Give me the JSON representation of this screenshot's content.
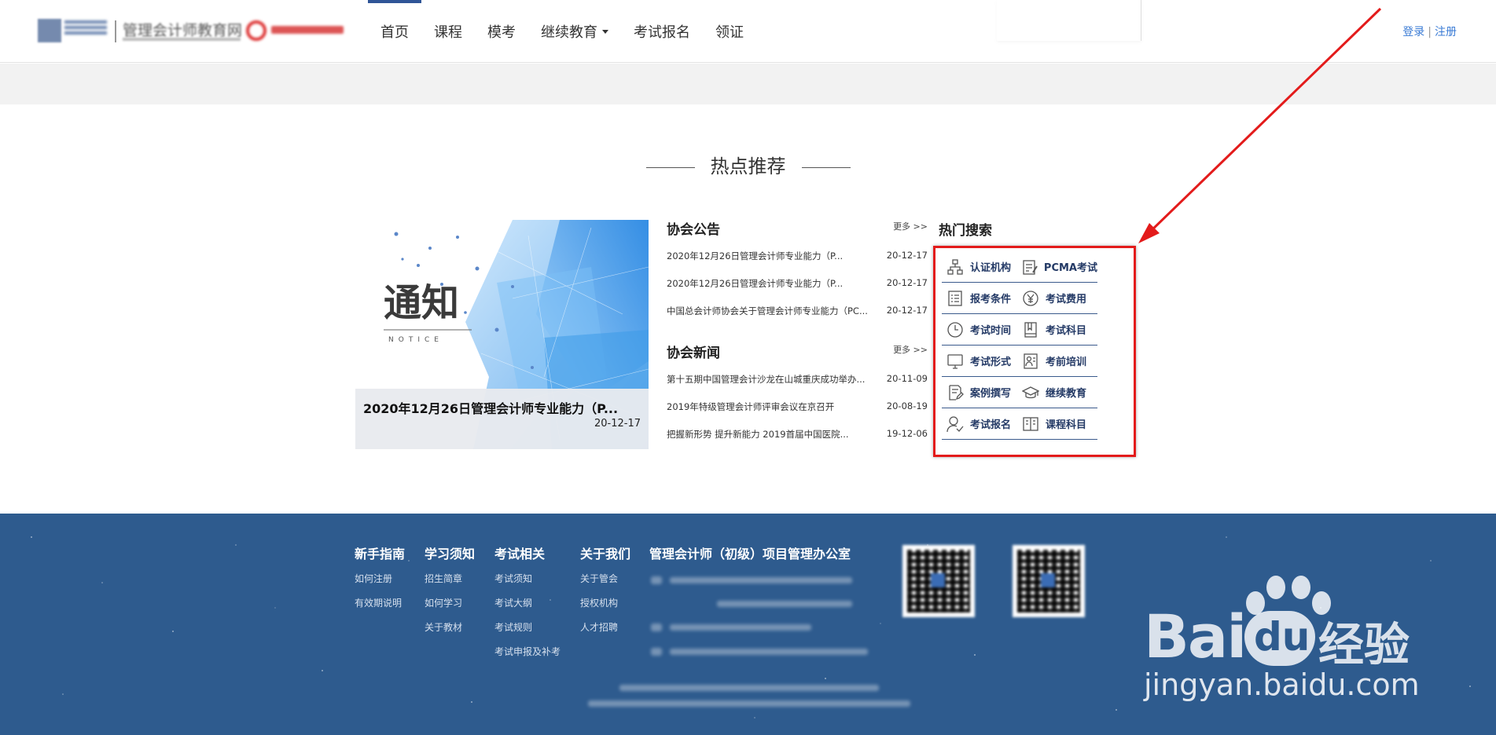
{
  "header": {
    "logo_text": "管理会计师教育网",
    "nav": [
      {
        "label": "首页"
      },
      {
        "label": "课程"
      },
      {
        "label": "模考"
      },
      {
        "label": "继续教育"
      },
      {
        "label": "考试报名"
      },
      {
        "label": "领证"
      }
    ],
    "login": "登录",
    "auth_sep": "|",
    "register": "注册"
  },
  "section_title": "热点推荐",
  "featured": {
    "image_text": "通知",
    "image_subtext": "NOTICE",
    "title": "2020年12月26日管理会计师专业能力（P...",
    "date": "20-12-17"
  },
  "announcements": {
    "title": "协会公告",
    "more": "更多 >>",
    "items": [
      {
        "title": "2020年12月26日管理会计师专业能力（P...",
        "date": "20-12-17"
      },
      {
        "title": "2020年12月26日管理会计师专业能力（P...",
        "date": "20-12-17"
      },
      {
        "title": "中国总会计师协会关于管理会计师专业能力（PC...",
        "date": "20-12-17"
      }
    ]
  },
  "news": {
    "title": "协会新闻",
    "more": "更多 >>",
    "items": [
      {
        "title": "第十五期中国管理会计沙龙在山城重庆成功举办...",
        "date": "20-11-09"
      },
      {
        "title": "2019年特级管理会计师评审会议在京召开",
        "date": "20-08-19"
      },
      {
        "title": "把握新形势 提升新能力 2019首届中国医院...",
        "date": "19-12-06"
      }
    ]
  },
  "hot_search": {
    "title": "热门搜索",
    "items": [
      {
        "label": "认证机构",
        "icon": "org-chart-icon"
      },
      {
        "label": "PCMA考试",
        "icon": "document-edit-icon"
      },
      {
        "label": "报考条件",
        "icon": "checklist-icon"
      },
      {
        "label": "考试费用",
        "icon": "yen-icon"
      },
      {
        "label": "考试时间",
        "icon": "clock-icon"
      },
      {
        "label": "考试科目",
        "icon": "book-icon"
      },
      {
        "label": "考试形式",
        "icon": "monitor-icon"
      },
      {
        "label": "考前培训",
        "icon": "trainer-icon"
      },
      {
        "label": "案例撰写",
        "icon": "write-icon"
      },
      {
        "label": "继续教育",
        "icon": "graduation-cap-icon"
      },
      {
        "label": "考试报名",
        "icon": "user-check-icon"
      },
      {
        "label": "课程科目",
        "icon": "open-book-icon"
      }
    ]
  },
  "footer": {
    "columns": [
      {
        "title": "新手指南",
        "links": [
          "如何注册",
          "有效期说明"
        ]
      },
      {
        "title": "学习须知",
        "links": [
          "招生简章",
          "如何学习",
          "关于教材"
        ]
      },
      {
        "title": "考试相关",
        "links": [
          "考试须知",
          "考试大纲",
          "考试规则",
          "考试申报及补考"
        ]
      },
      {
        "title": "关于我们",
        "links": [
          "关于管会",
          "授权机构",
          "人才招聘"
        ]
      }
    ],
    "contact_title": "管理会计师（初级）项目管理办公室"
  },
  "colors": {
    "nav_active": "#2f5597",
    "footer_bg": "#2e5b8e",
    "highlight_box": "#e31b1b",
    "hot_text": "#243a66"
  }
}
